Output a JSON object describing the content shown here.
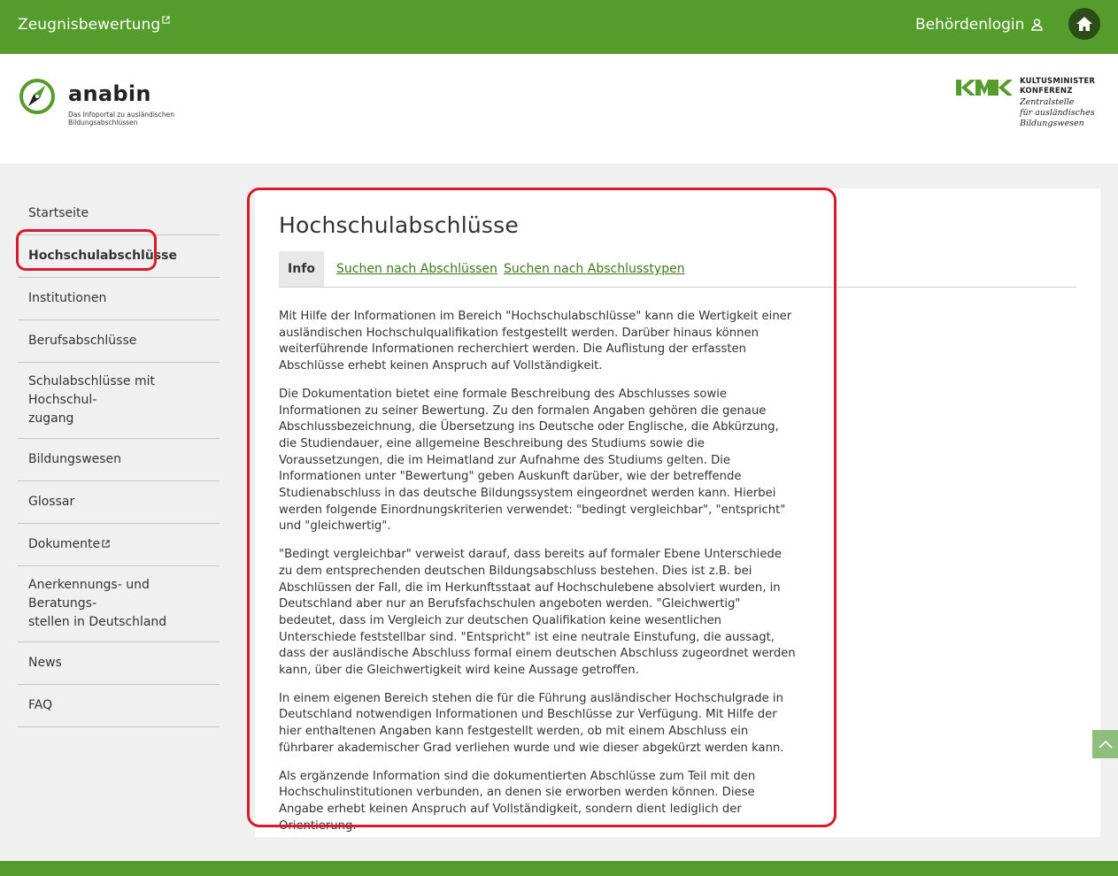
{
  "topbar": {
    "brand_label": "Zeugnisbewertung",
    "login_label": "Behördenlogin"
  },
  "header": {
    "logo_word": "anabin",
    "logo_tagline": "Das Infoportal zu ausländischen Bildungsabschlüssen",
    "kmk_line1": "KULTUSMINISTER",
    "kmk_line2": "KONFERENZ",
    "kmk_line3": "Zentralstelle",
    "kmk_line4": "für ausländisches",
    "kmk_line5": "Bildungswesen"
  },
  "sidebar": {
    "items": [
      {
        "label": "Startseite"
      },
      {
        "label": "Hochschulabschlüsse"
      },
      {
        "label": "Institutionen"
      },
      {
        "label": "Berufsabschlüsse"
      },
      {
        "label": "Schulabschlüsse mit Hochschul-\nzugang"
      },
      {
        "label": "Bildungswesen"
      },
      {
        "label": "Glossar"
      },
      {
        "label": "Dokumente"
      },
      {
        "label": "Anerkennungs- und Beratungs-\nstellen in Deutschland"
      },
      {
        "label": "News"
      },
      {
        "label": "FAQ"
      }
    ]
  },
  "main": {
    "title": "Hochschulabschlüsse",
    "tabs": [
      {
        "label": "Info"
      },
      {
        "label": "Suchen nach Abschlüssen"
      },
      {
        "label": "Suchen nach Abschlusstypen"
      }
    ],
    "paragraphs": [
      "Mit Hilfe der Informationen im Bereich \"Hochschulabschlüsse\" kann die Wertigkeit einer ausländischen Hochschulqualifikation festgestellt werden. Darüber hinaus können weiterführende Informationen recherchiert werden. Die Auflistung der erfassten Abschlüsse erhebt keinen Anspruch auf Vollständigkeit.",
      "Die Dokumentation bietet eine formale Beschreibung des Abschlusses sowie Informationen zu seiner Bewertung. Zu den formalen Angaben gehören die genaue Abschlussbezeichnung, die Übersetzung ins Deutsche oder Englische, die Abkürzung, die Studiendauer, eine allgemeine Beschreibung des Studiums sowie die Voraussetzungen, die im Heimatland zur Aufnahme des Studiums gelten. Die Informationen unter \"Bewertung\" geben Auskunft darüber, wie der betreffende Studienabschluss in das deutsche Bildungssystem eingeordnet werden kann. Hierbei werden folgende Einordnungskriterien verwendet: \"bedingt vergleichbar\", \"entspricht\" und \"gleichwertig\".",
      "\"Bedingt vergleichbar\" verweist darauf, dass bereits auf formaler Ebene Unterschiede zu dem entsprechenden deutschen Bildungsabschluss bestehen. Dies ist z.B. bei Abschlüssen der Fall, die im Herkunftsstaat auf Hochschulebene absolviert wurden, in Deutschland aber nur an Berufsfachschulen angeboten werden. \"Gleichwertig\" bedeutet, dass im Vergleich zur deutschen Qualifikation keine wesentlichen Unterschiede feststellbar sind. \"Entspricht\" ist eine neutrale Einstufung, die aussagt, dass der ausländische Abschluss formal einem deutschen Abschluss zugeordnet werden kann, über die Gleichwertigkeit wird keine Aussage getroffen.",
      "In einem eigenen Bereich stehen die für die Führung ausländischer Hochschulgrade in Deutschland notwendigen Informationen und Beschlüsse zur Verfügung. Mit Hilfe der hier enthaltenen Angaben kann festgestellt werden, ob mit einem Abschluss ein führbarer akademischer Grad verliehen wurde und wie dieser abgekürzt werden kann.",
      "Als ergänzende Information sind die dokumentierten Abschlüsse zum Teil mit den Hochschulinstitutionen verbunden, an denen sie erworben werden können. Diese Angabe erhebt keinen Anspruch auf Vollständigkeit, sondern dient lediglich der Orientierung."
    ]
  },
  "colors": {
    "brand_green": "#549d2c",
    "link_green": "#3e7a1d",
    "highlight_red": "#d91a2a"
  },
  "icons": {
    "external": "external-link-icon",
    "user": "user-icon",
    "home": "home-icon",
    "scroll_top": "chevron-up-icon"
  }
}
